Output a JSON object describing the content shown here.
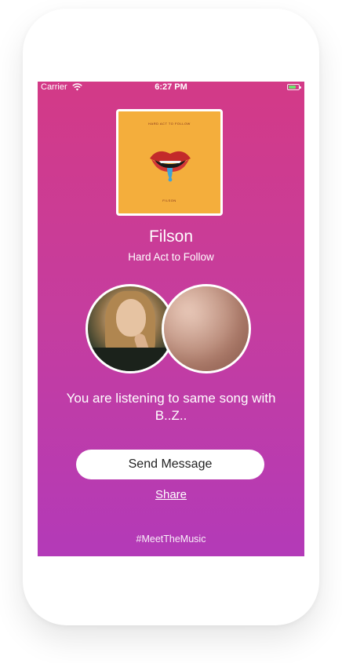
{
  "status_bar": {
    "carrier": "Carrier",
    "time": "6:27 PM"
  },
  "album": {
    "cover_title": "HARD ACT TO FOLLOW",
    "cover_artist": "FILSON"
  },
  "track": {
    "artist": "Filson",
    "title": "Hard Act to Follow"
  },
  "match": {
    "message": "You are listening to same song with B..Z.."
  },
  "actions": {
    "send_message": "Send Message",
    "share": "Share"
  },
  "footer": {
    "hashtag": "#MeetTheMusic"
  },
  "colors": {
    "gradient_top": "#d33a87",
    "gradient_bottom": "#b33ab8",
    "album_bg": "#f4ae3c",
    "button_bg": "#ffffff"
  }
}
